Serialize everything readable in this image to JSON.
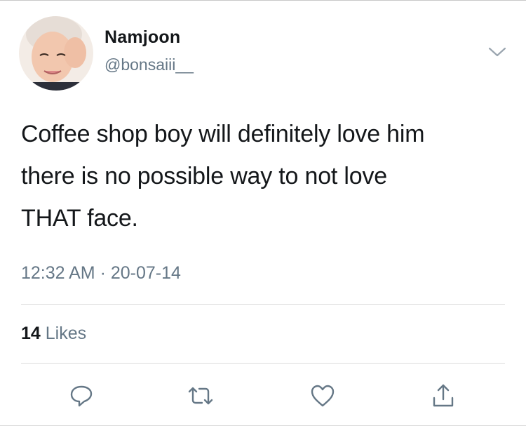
{
  "tweet": {
    "display_name": "Namjoon",
    "handle": "@bonsaiii__",
    "text_lines": [
      "Coffee shop boy will definitely love him",
      "there is no possible way to not love",
      "THAT face."
    ],
    "timestamp": "12:32 AM · 20-07-14",
    "likes_count": "14",
    "likes_label": "Likes"
  },
  "icons": {
    "menu": "chevron-down-icon",
    "reply": "reply-icon",
    "retweet": "retweet-icon",
    "like": "heart-icon",
    "share": "share-icon"
  },
  "colors": {
    "text_primary": "#14171a",
    "text_secondary": "#657786",
    "icon_gray": "#657786",
    "divider": "#dcdcdc"
  }
}
